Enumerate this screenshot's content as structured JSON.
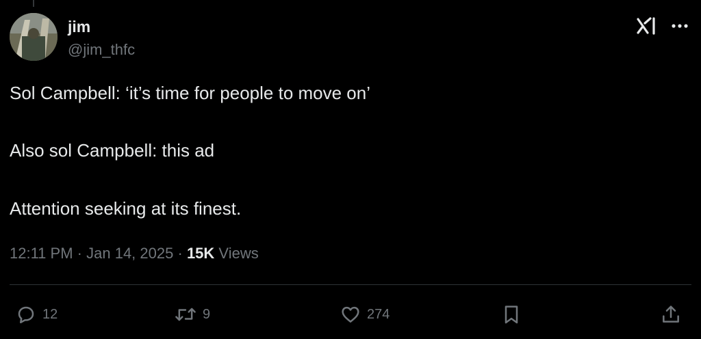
{
  "tweet": {
    "display_name": "jim",
    "handle": "@jim_thfc",
    "lines": [
      "Sol Campbell: ‘it’s time for people to move on’",
      "Also sol Campbell: this ad",
      "Attention seeking at its finest."
    ],
    "time": "12:11 PM",
    "separator": "·",
    "date": "Jan 14, 2025",
    "views_count": "15K",
    "views_label": "Views"
  },
  "actions": {
    "replies": "12",
    "reposts": "9",
    "likes": "274"
  },
  "icons": {
    "top_right": [
      "grok-icon",
      "more-icon"
    ],
    "action_bar": [
      "reply-icon",
      "repost-icon",
      "like-icon",
      "bookmark-icon",
      "share-icon"
    ]
  },
  "colors": {
    "background": "#000000",
    "primary_text": "#e7e9ea",
    "secondary_text": "#71767b",
    "divider": "#2f3336"
  }
}
